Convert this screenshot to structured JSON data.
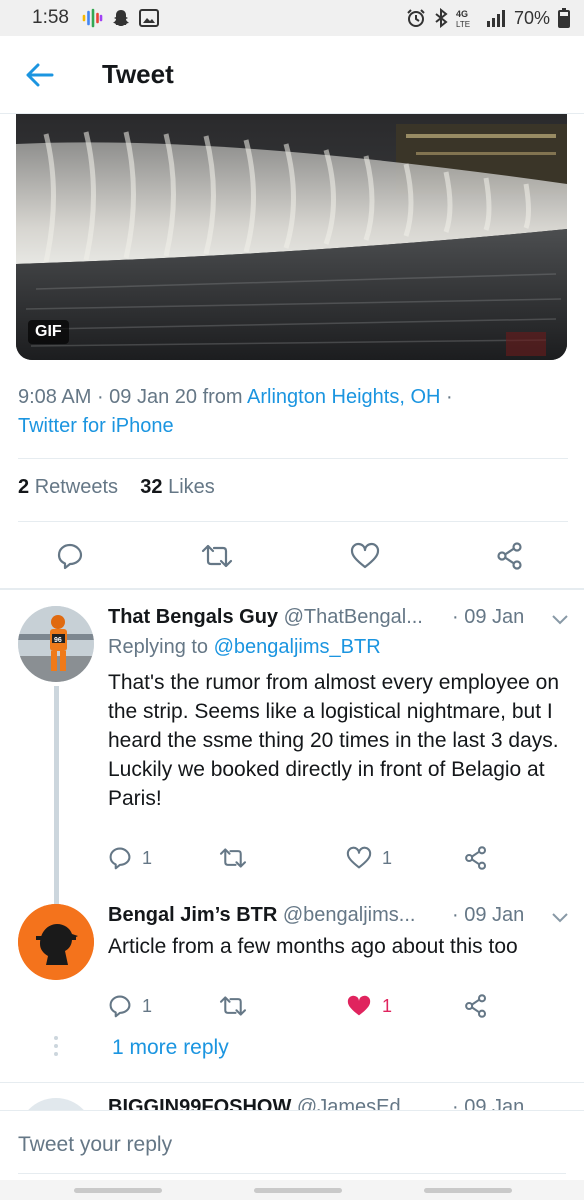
{
  "status_bar": {
    "time": "1:58",
    "battery": "70%",
    "network": "4G LTE"
  },
  "header": {
    "title": "Tweet",
    "back_icon": "arrow-left-icon"
  },
  "media": {
    "badge": "GIF"
  },
  "tweet_meta": {
    "time": "9:08 AM",
    "date": "09 Jan 20",
    "from_label": "from",
    "location": "Arlington Heights, OH",
    "source": "Twitter for iPhone"
  },
  "stats": {
    "retweets_count": "2",
    "retweets_label": "Retweets",
    "likes_count": "32",
    "likes_label": "Likes"
  },
  "replies": [
    {
      "name": "That Bengals Guy",
      "handle": "@ThatBengal...",
      "date": "· 09 Jan",
      "replying_to_label": "Replying to",
      "replying_to_handle": "@bengaljims_BTR",
      "text": "That's the rumor from almost every employee on the strip. Seems like a logistical nightmare, but I heard the ssme thing 20 times in the last 3 days. Luckily we booked directly in front of Belagio at Paris!",
      "reply_count": "1",
      "like_count": "1",
      "liked": false
    },
    {
      "name": "Bengal Jim’s  BTR",
      "handle": "@bengaljims...",
      "date": "· 09 Jan",
      "text": "Article from a few months ago about this too",
      "reply_count": "1",
      "like_count": "1",
      "liked": true
    }
  ],
  "more_reply": "1 more reply",
  "peek_reply": {
    "name": "BIGGIN99FOSHOW",
    "handle": "@JamesEd...",
    "date": "· 09 Jan"
  },
  "composer": {
    "placeholder": "Tweet your reply"
  },
  "colors": {
    "accent": "#1b95e0",
    "like_red": "#e0245e",
    "muted": "#657786"
  }
}
